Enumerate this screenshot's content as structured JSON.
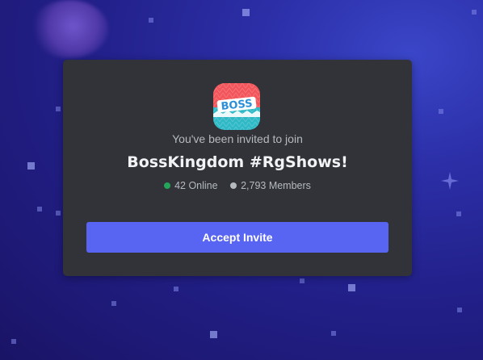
{
  "invite": {
    "subtitle": "You've been invited to join",
    "server_name": "BossKingdom #RgShows!",
    "online_count": "42 Online",
    "member_count": "2,793 Members",
    "accept_label": "Accept Invite",
    "server_icon_text": "BOSS"
  },
  "colors": {
    "accent": "#5865f2",
    "online_dot": "#23a55a",
    "members_dot": "#b5bac1",
    "modal_bg": "#313338",
    "icon_top": "#f2555a",
    "icon_bottom": "#2fb8c6"
  },
  "icons": {
    "server_icon": "server-logo-icon",
    "background": "sparkle-icon"
  }
}
